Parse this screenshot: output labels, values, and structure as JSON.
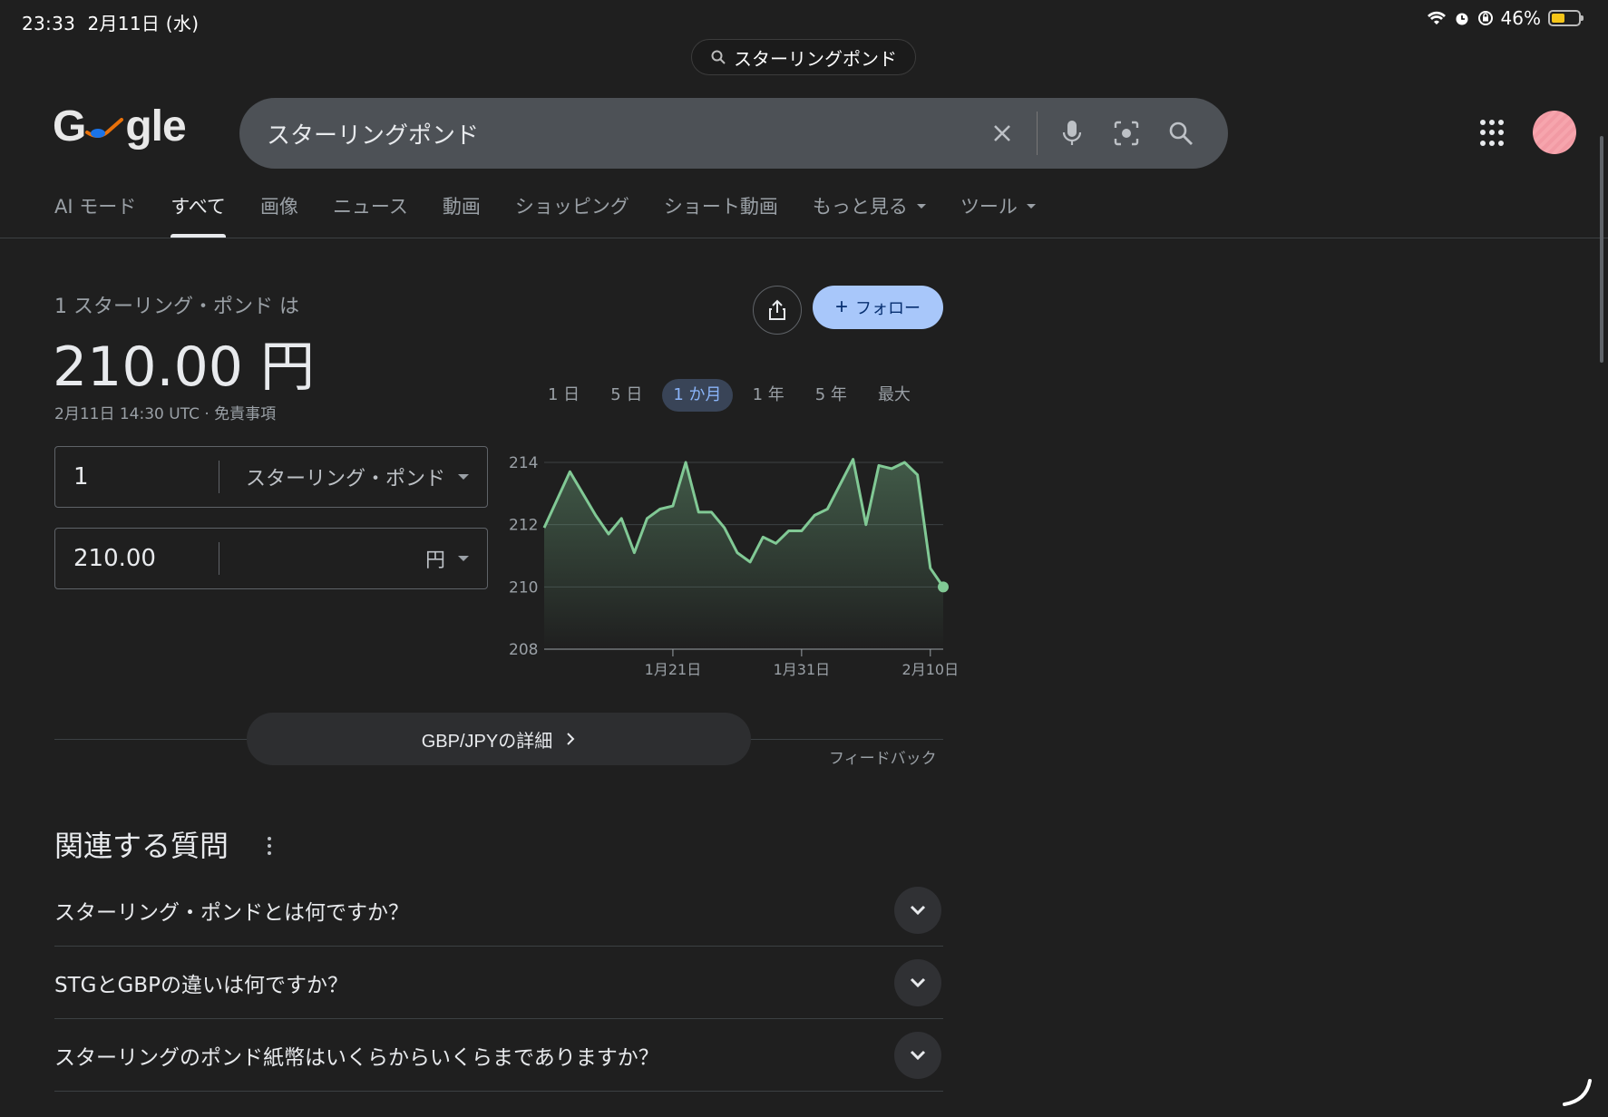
{
  "status_bar": {
    "time": "23:33",
    "date": "2月11日 (水)",
    "battery": "46%"
  },
  "url_bar": {
    "text": "スターリングポンド"
  },
  "header": {
    "logo_text": "Google",
    "search_value": "スターリングポンド"
  },
  "tabs": [
    {
      "label": "AI モード"
    },
    {
      "label": "すべて"
    },
    {
      "label": "画像"
    },
    {
      "label": "ニュース"
    },
    {
      "label": "動画"
    },
    {
      "label": "ショッピング"
    },
    {
      "label": "ショート動画"
    },
    {
      "label": "もっと見る"
    },
    {
      "label": "ツール"
    }
  ],
  "finance": {
    "label": "1 スターリング・ポンド は",
    "result": "210.00 円",
    "timestamp": "2月11日 14:30 UTC · 免責事項",
    "follow_label": "フォロー",
    "from_amount": "1",
    "from_unit": "スターリング・ポンド",
    "to_amount": "210.00",
    "to_unit": "円",
    "ranges": [
      "1 日",
      "5 日",
      "1 か月",
      "1 年",
      "5 年",
      "最大"
    ],
    "active_range": "1 か月",
    "details_label": "GBP/JPYの詳細",
    "feedback_label": "フィードバック"
  },
  "chart_data": {
    "type": "area",
    "title": "",
    "xlabel": "",
    "ylabel": "",
    "ylim": [
      208,
      214
    ],
    "yticks": [
      214,
      212,
      210,
      208
    ],
    "xticks": [
      "1月21日",
      "1月31日",
      "2月10日"
    ],
    "xtick_index": [
      10,
      20,
      30
    ],
    "color": "#81c995",
    "values": [
      211.9,
      212.8,
      213.7,
      213.0,
      212.3,
      211.7,
      212.2,
      211.1,
      212.2,
      212.5,
      212.6,
      214.0,
      212.4,
      212.4,
      211.9,
      211.1,
      210.8,
      211.6,
      211.4,
      211.8,
      211.8,
      212.3,
      212.5,
      213.3,
      214.1,
      212.0,
      213.9,
      213.8,
      214.0,
      213.6,
      210.6,
      210.0
    ]
  },
  "related_questions": {
    "title": "関連する質問",
    "items": [
      {
        "q": "スターリング・ポンドとは何ですか？"
      },
      {
        "q": "STGとGBPの違いは何ですか？"
      },
      {
        "q": "スターリングのポンド紙幣はいくらからいくらまでありますか？"
      }
    ]
  },
  "colors": {
    "background": "#1f1f1f",
    "accent": "#a8c7fa",
    "chart_line": "#81c995"
  }
}
